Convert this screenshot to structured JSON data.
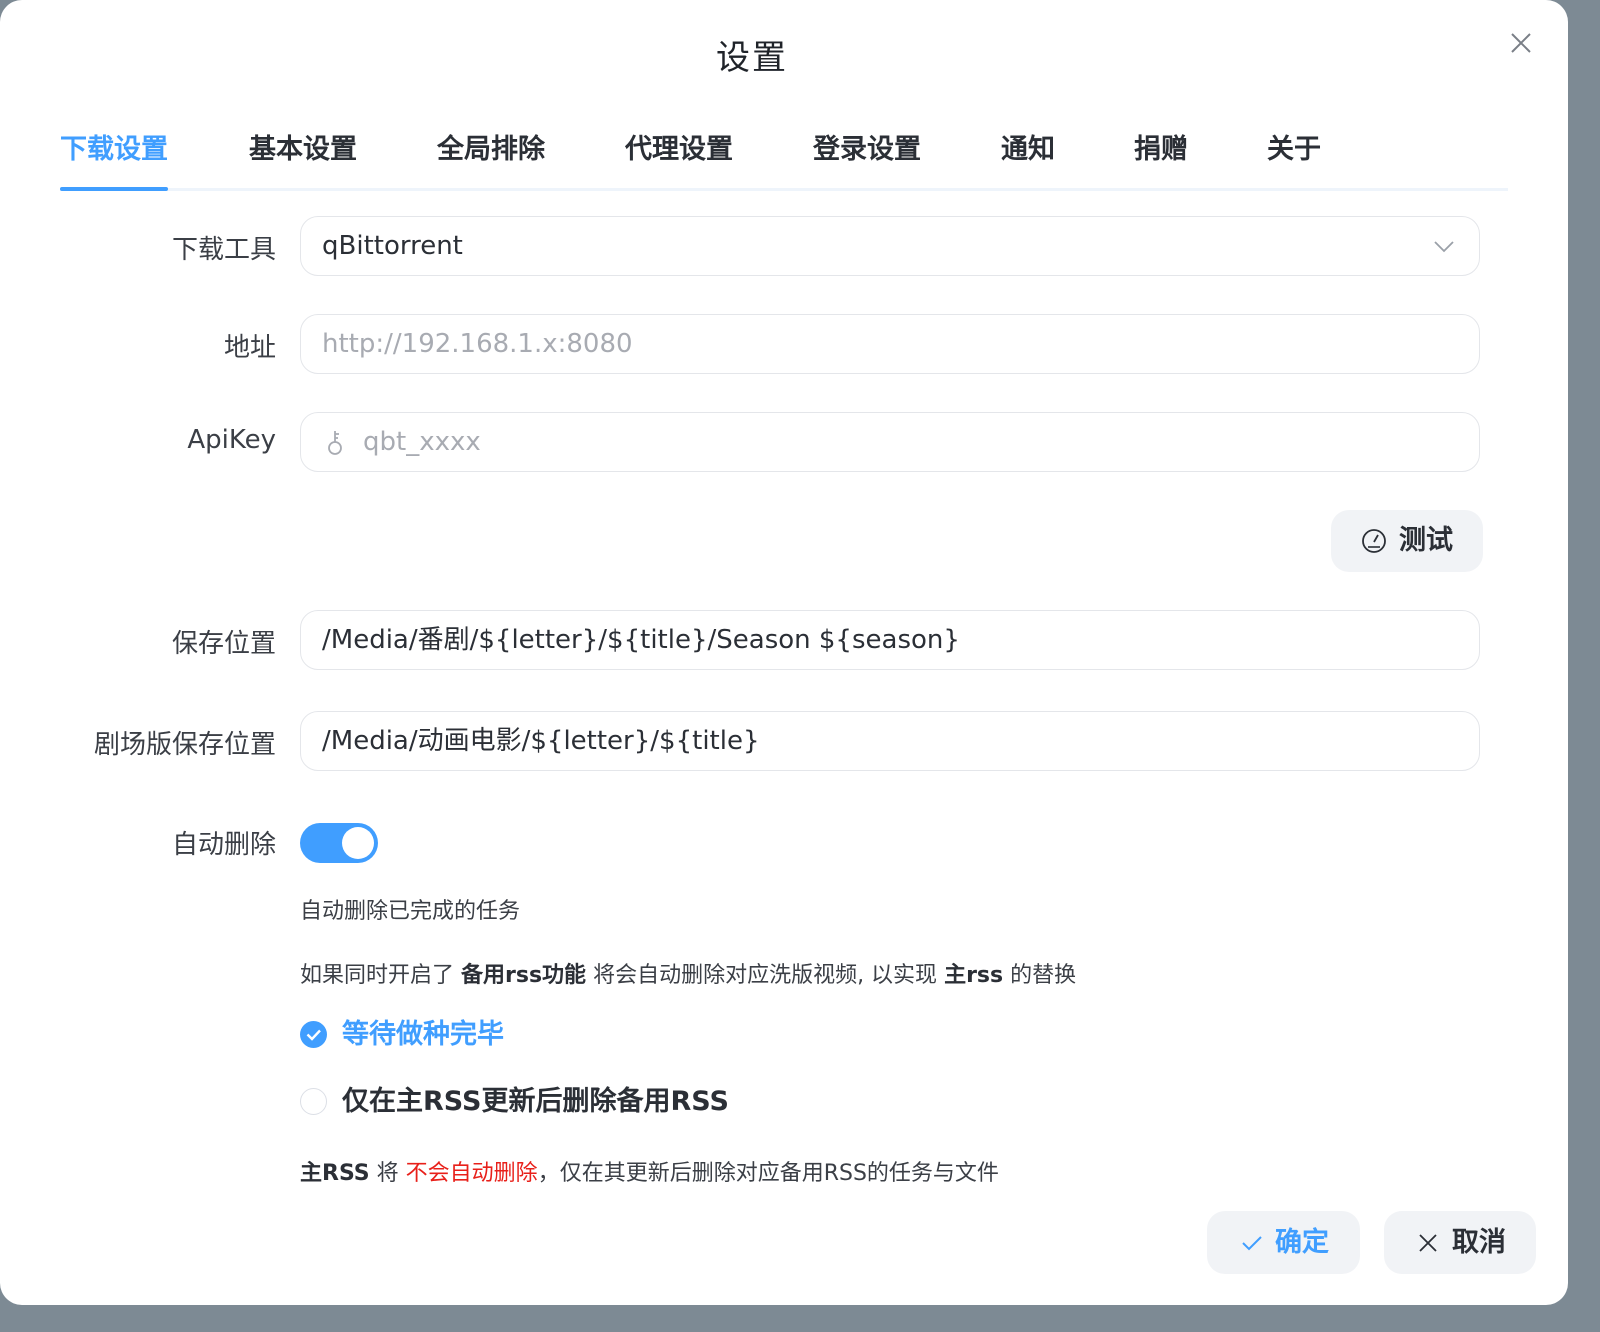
{
  "dialog": {
    "title": "设置"
  },
  "tabs": [
    {
      "label": "下载设置",
      "active": true
    },
    {
      "label": "基本设置"
    },
    {
      "label": "全局排除"
    },
    {
      "label": "代理设置"
    },
    {
      "label": "登录设置"
    },
    {
      "label": "通知"
    },
    {
      "label": "捐赠"
    },
    {
      "label": "关于"
    }
  ],
  "form": {
    "download_tool": {
      "label": "下载工具",
      "value": "qBittorrent"
    },
    "address": {
      "label": "地址",
      "placeholder": "http://192.168.1.x:8080"
    },
    "apikey": {
      "label": "ApiKey",
      "placeholder": "qbt_xxxx"
    },
    "test_button": {
      "label": "测试"
    },
    "save_path": {
      "label": "保存位置",
      "value": "/Media/番剧/${letter}/${title}/Season ${season}"
    },
    "movie_save_path": {
      "label": "剧场版保存位置",
      "value": "/Media/动画电影/${letter}/${title}"
    },
    "auto_delete": {
      "label": "自动删除",
      "enabled": true,
      "desc": "自动删除已完成的任务",
      "info": {
        "prefix": "如果同时开启了",
        "bold1": "备用rss功能",
        "middle": "将会自动删除对应洗版视频, 以实现",
        "bold2": "主rss",
        "suffix": "的替换"
      },
      "options": [
        {
          "label": "等待做种完毕",
          "checked": true
        },
        {
          "label": "仅在主RSS更新后删除备用RSS",
          "checked": false
        }
      ],
      "footnote": {
        "bold": "主RSS",
        "word": "将",
        "red": "不会自动删除",
        "rest": "，仅在其更新后删除对应备用RSS的任务与文件"
      }
    }
  },
  "footer": {
    "ok_label": "确定",
    "cancel_label": "取消"
  },
  "colors": {
    "accent": "#409eff",
    "danger": "#e8201a"
  }
}
